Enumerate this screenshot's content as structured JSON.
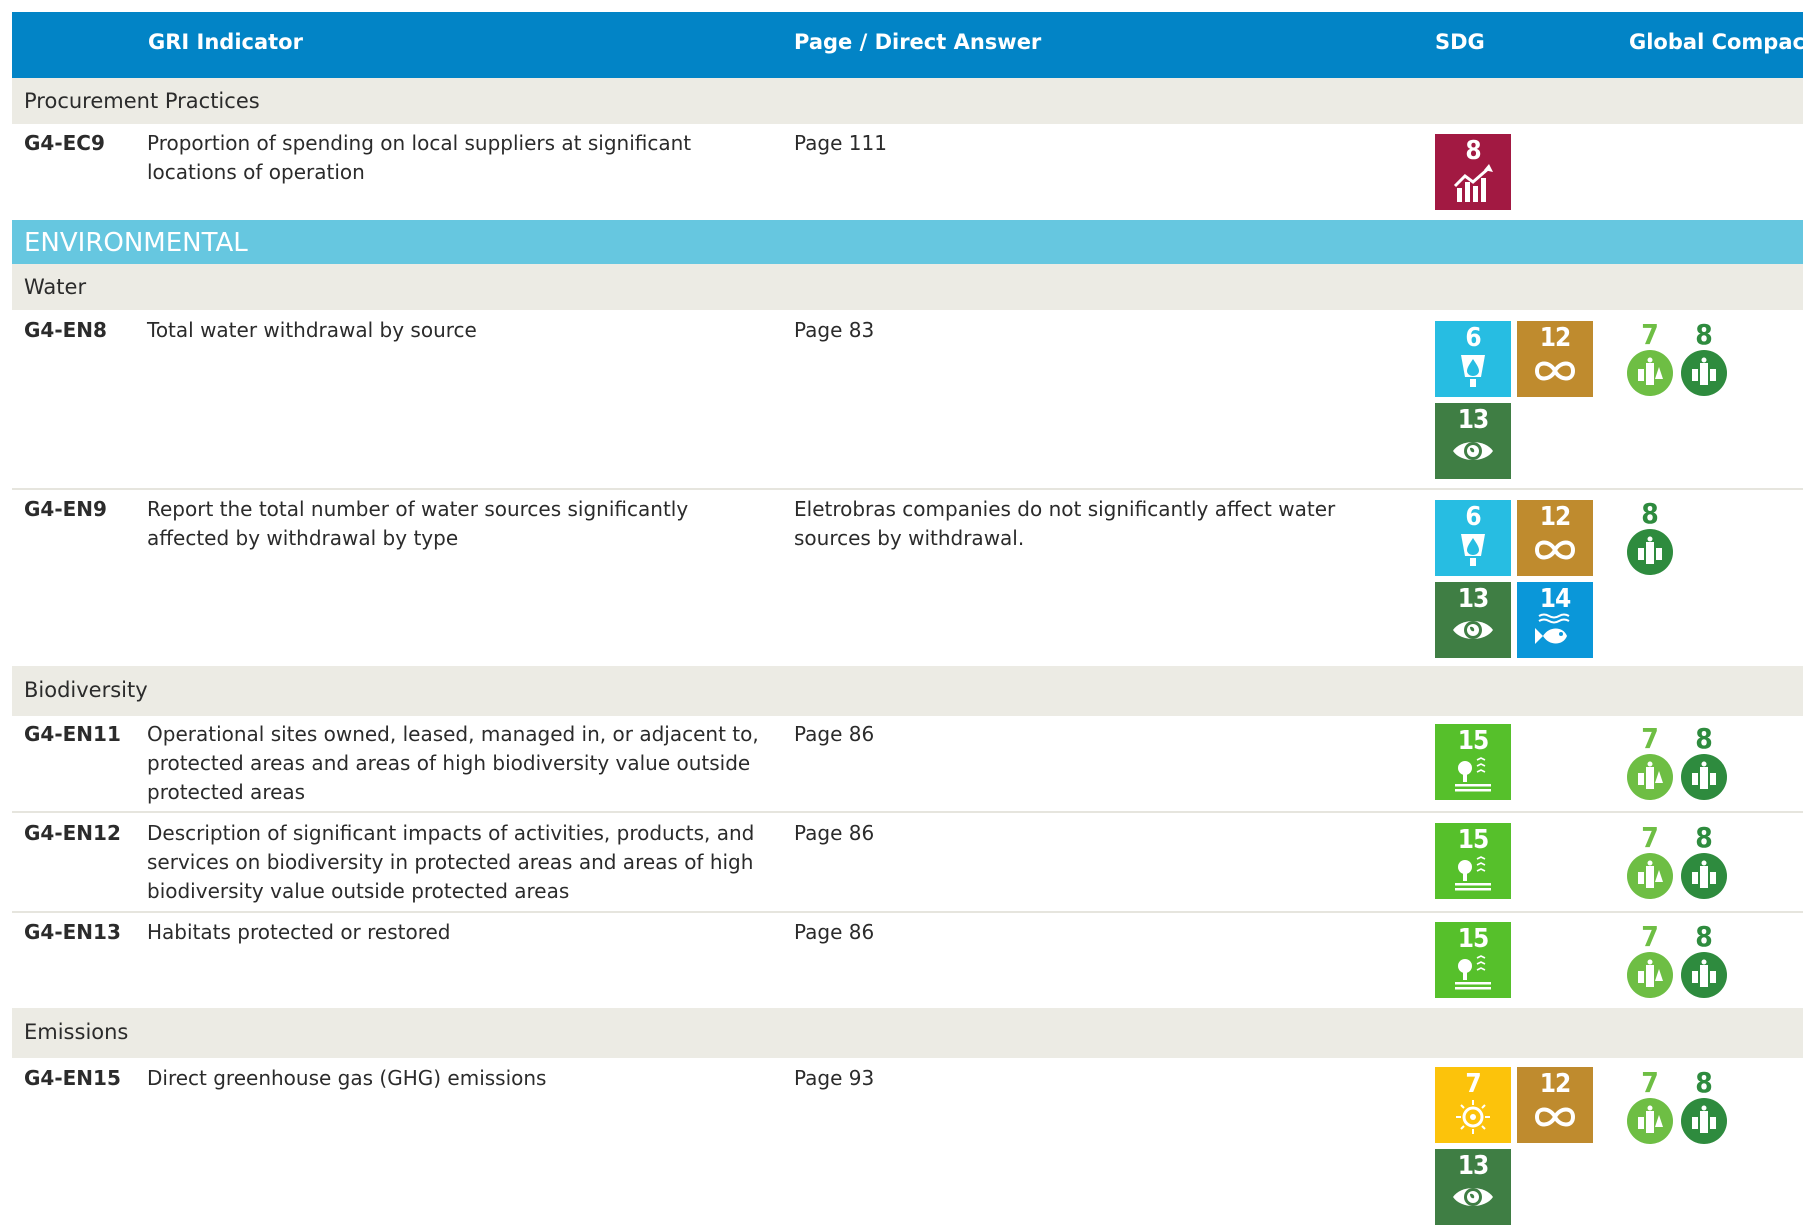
{
  "header": {
    "col_indicator": "GRI Indicator",
    "col_answer": "Page / Direct Answer",
    "col_sdg": "SDG",
    "col_gc": "Global Compact"
  },
  "sections": {
    "procurement": "Procurement Practices",
    "environmental": "ENVIRONMENTAL",
    "water": "Water",
    "biodiversity": "Biodiversity",
    "emissions": "Emissions"
  },
  "rows": {
    "ec9": {
      "code": "G4-EC9",
      "desc": "Proportion of spending on local suppliers at significant locations of operation",
      "answer": "Page 111",
      "sdgs": [
        "8"
      ],
      "gc": []
    },
    "en8": {
      "code": "G4-EN8",
      "desc": "Total water withdrawal by source",
      "answer": "Page 83",
      "sdgs": [
        "6",
        "12",
        "13"
      ],
      "gc": [
        "7",
        "8"
      ]
    },
    "en9": {
      "code": "G4-EN9",
      "desc": "Report the total number of water sources significantly affected by withdrawal by type",
      "answer": "Eletrobras companies do not significantly affect water sources by withdrawal.",
      "sdgs": [
        "6",
        "12",
        "13",
        "14"
      ],
      "gc": [
        "8"
      ]
    },
    "en11": {
      "code": "G4-EN11",
      "desc": "Operational sites owned, leased, managed in, or adjacent to, protected areas and areas of high biodiversity value outside protected areas",
      "answer": "Page 86",
      "sdgs": [
        "15"
      ],
      "gc": [
        "7",
        "8"
      ]
    },
    "en12": {
      "code": "G4-EN12",
      "desc": "Description of significant impacts of activities, products, and services on biodiversity in protected areas and areas of high biodiversity value outside protected areas",
      "answer": "Page 86",
      "sdgs": [
        "15"
      ],
      "gc": [
        "7",
        "8"
      ]
    },
    "en13": {
      "code": "G4-EN13",
      "desc": "Habitats protected or restored",
      "answer": "Page 86",
      "sdgs": [
        "15"
      ],
      "gc": [
        "7",
        "8"
      ]
    },
    "en15": {
      "code": "G4-EN15",
      "desc": "Direct greenhouse gas (GHG) emissions",
      "answer": "Page 93",
      "sdgs": [
        "7",
        "12",
        "13"
      ],
      "gc": [
        "7",
        "8"
      ]
    }
  },
  "colors": {
    "header": "#0284c6",
    "environmental": "#66c7e0",
    "section": "#ecebe4",
    "sdg6": "#27bde2",
    "sdg7": "#fcc30b",
    "sdg8": "#a21942",
    "sdg12": "#bf8b2e",
    "sdg13": "#3f7e44",
    "sdg14": "#0a97d9",
    "sdg15": "#56c02b",
    "gc7": "#6ebe44",
    "gc8": "#2e8b3e"
  }
}
